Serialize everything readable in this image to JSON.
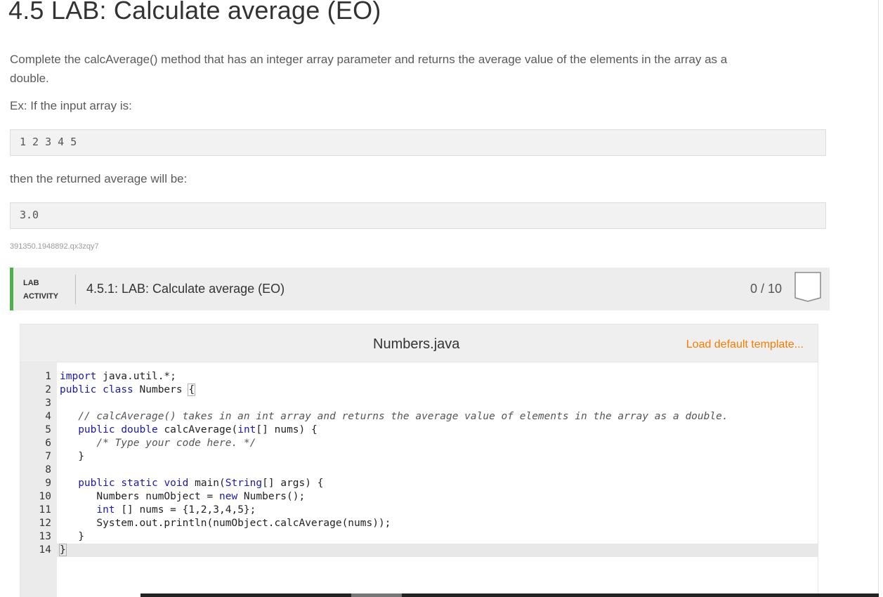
{
  "title": "4.5 LAB: Calculate average (EO)",
  "description": {
    "line1": "Complete the calcAverage() method that has an integer array parameter and returns the average value of the elements in the array as a",
    "line2": "double.",
    "example_intro": "Ex: If the input array is:",
    "example_input": "1 2 3 4 5",
    "then_text": "then the returned average will be:",
    "example_output": "3.0"
  },
  "lab_id": "391350.1948892.qx3zqy7",
  "lab_activity": {
    "tag_line1": "LAB",
    "tag_line2": "ACTIVITY",
    "name": "4.5.1: LAB: Calculate average (EO)",
    "score": "0 / 10"
  },
  "editor": {
    "file_name": "Numbers.java",
    "load_template_label": "Load default template...",
    "active_line": 14,
    "lines": [
      "import java.util.*;",
      "public class Numbers {",
      "",
      "   // calcAverage() takes in an int array and returns the average value of elements in the array as a double.",
      "   public double calcAverage(int[] nums) {",
      "      /* Type your code here. */",
      "   }",
      "",
      "   public static void main(String[] args) {",
      "      Numbers numObject = new Numbers();",
      "      int [] nums = {1,2,3,4,5};",
      "      System.out.println(numObject.calcAverage(nums));",
      "   }",
      "}"
    ]
  },
  "colors": {
    "accent_green": "#4caf50",
    "link_orange": "#f57c00",
    "keyword_blue": "#1a1aa6"
  }
}
